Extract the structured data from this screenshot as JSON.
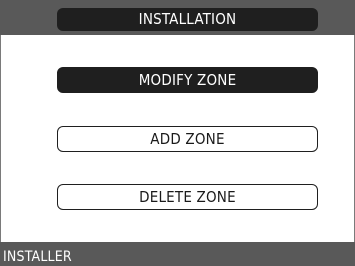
{
  "header": {
    "title": "INSTALLATION"
  },
  "menu": {
    "items": [
      {
        "label": "MODIFY ZONE",
        "selected": true
      },
      {
        "label": "ADD ZONE",
        "selected": false
      },
      {
        "label": "DELETE ZONE",
        "selected": false
      }
    ]
  },
  "footer": {
    "status": "INSTALLER"
  },
  "colors": {
    "bar_background": "#595959",
    "selected_background": "#1f1f1f",
    "selected_text": "#ffffff",
    "page_background": "#ffffff"
  }
}
